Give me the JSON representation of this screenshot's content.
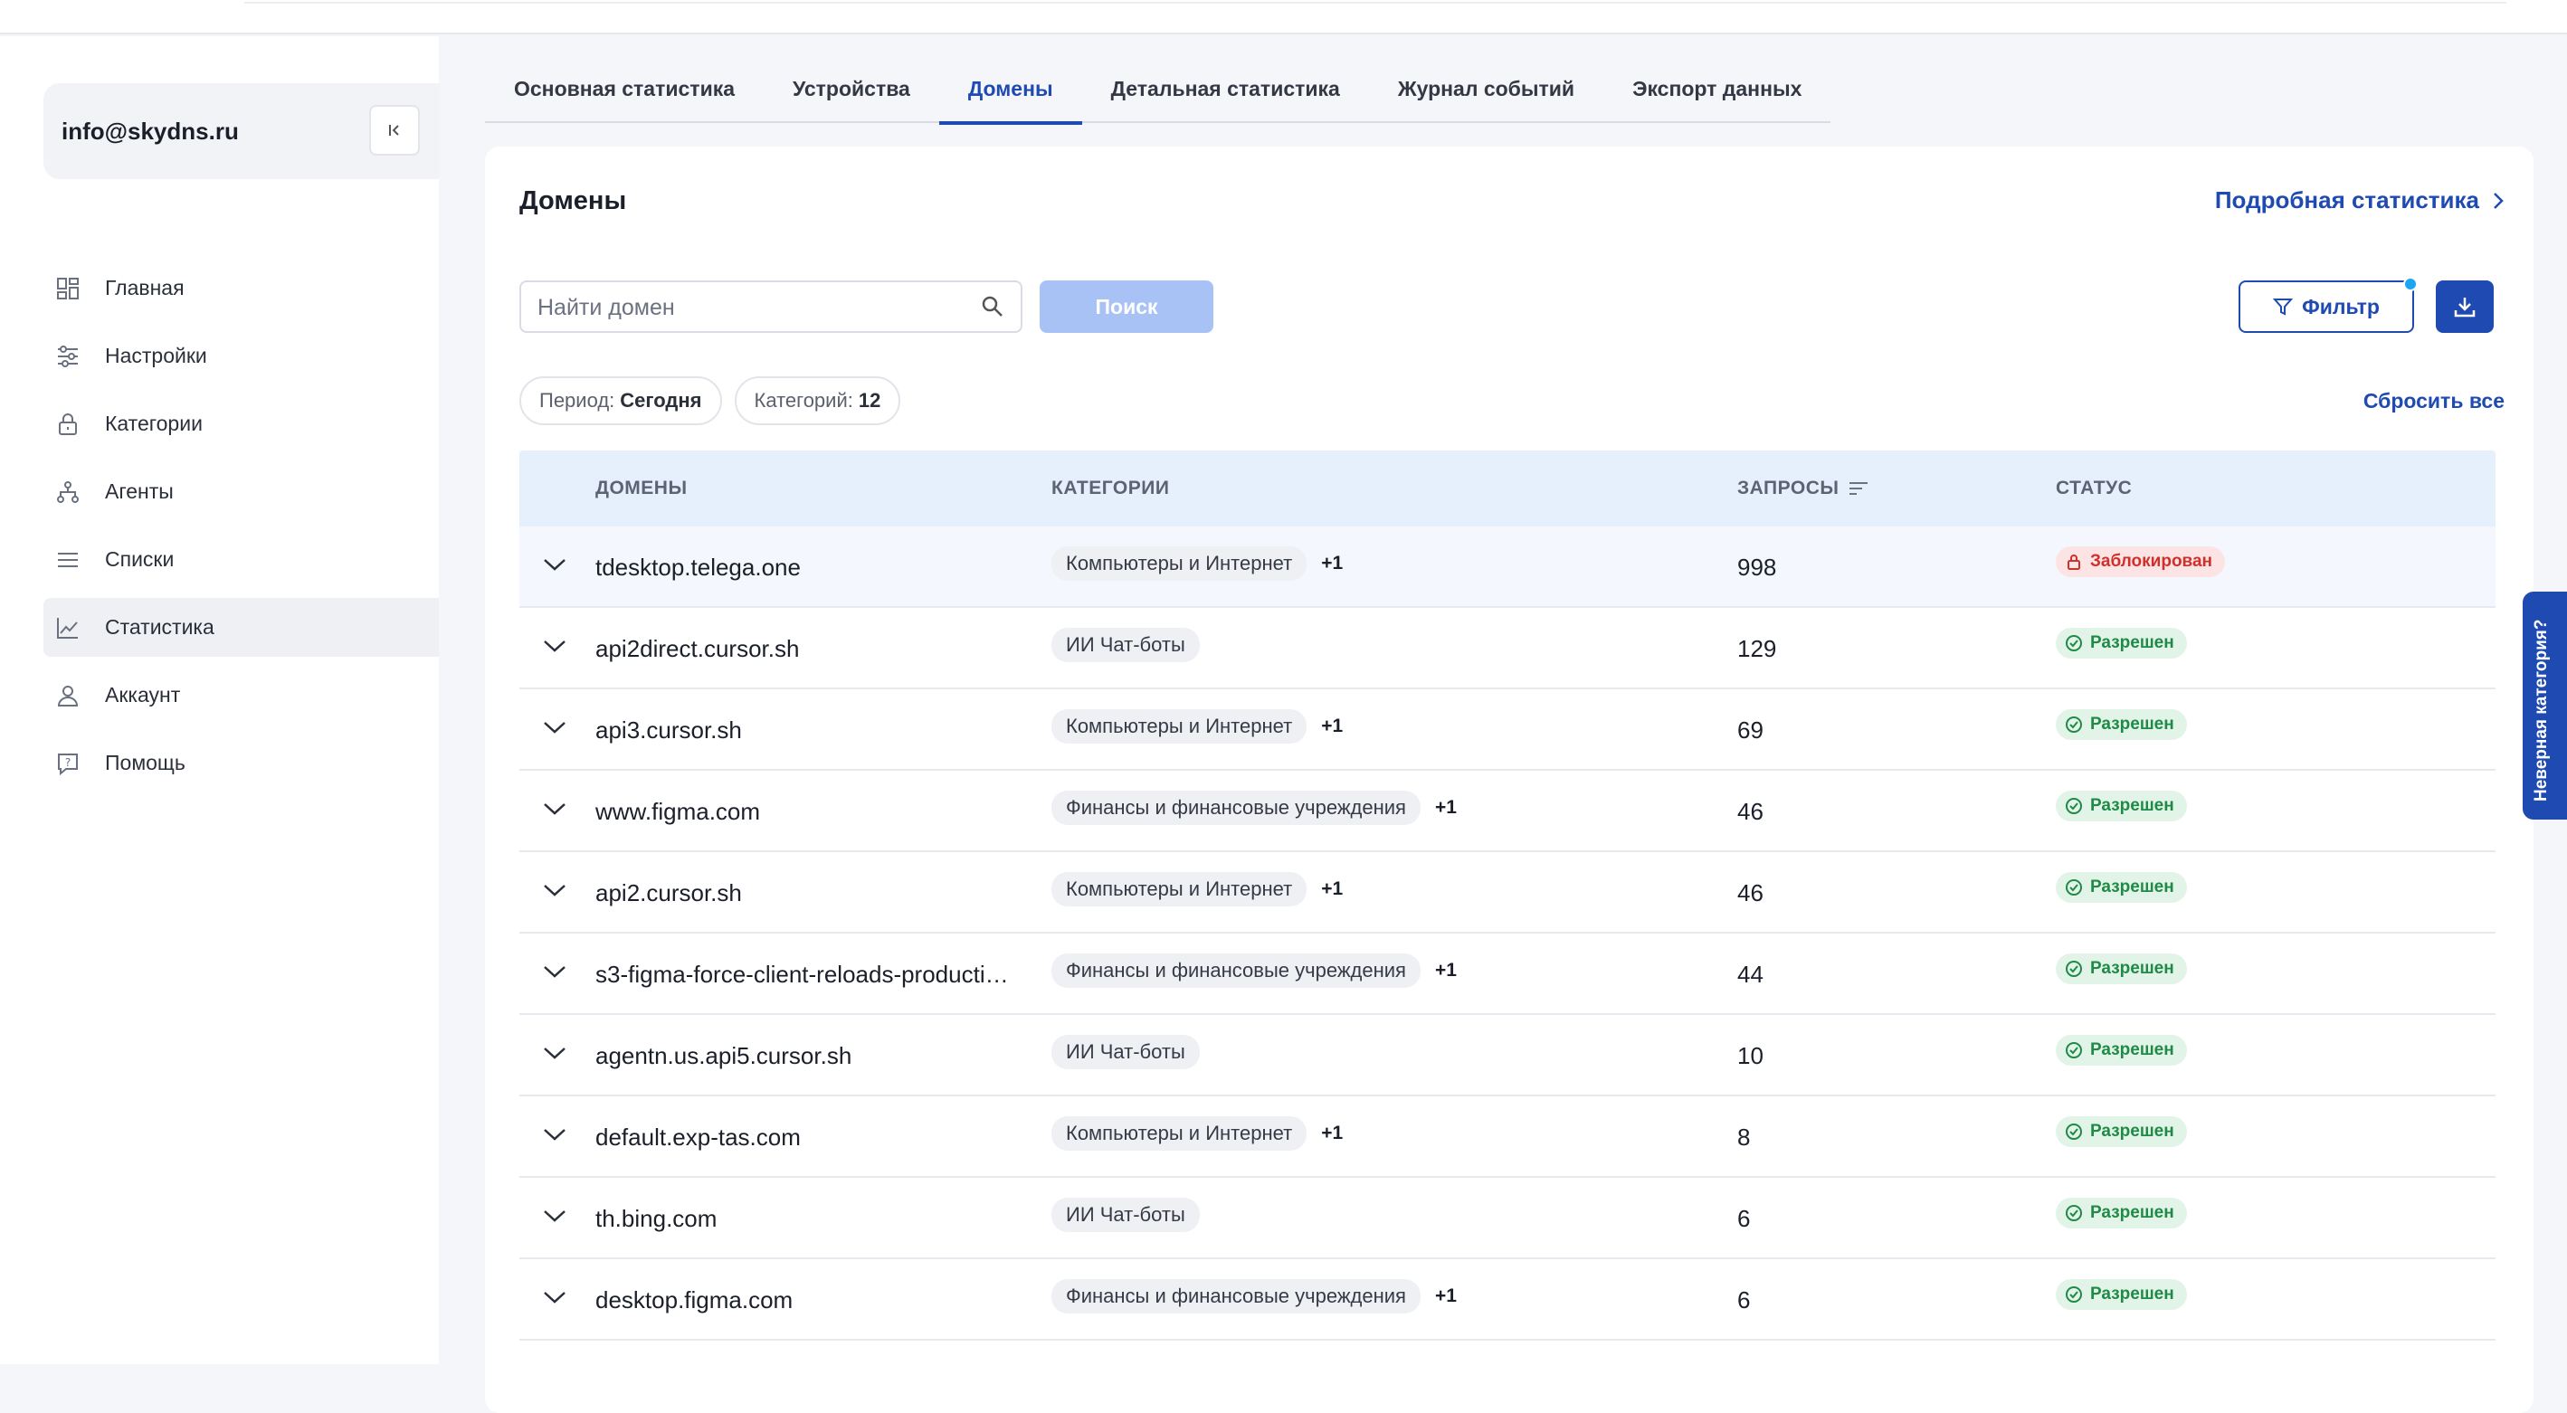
{
  "account": {
    "email": "info@skydns.ru"
  },
  "nav": [
    {
      "label": "Главная",
      "icon": "grid-icon"
    },
    {
      "label": "Настройки",
      "icon": "sliders-icon"
    },
    {
      "label": "Категории",
      "icon": "lock-icon"
    },
    {
      "label": "Агенты",
      "icon": "network-icon"
    },
    {
      "label": "Списки",
      "icon": "list-icon"
    },
    {
      "label": "Статистика",
      "icon": "chart-icon",
      "active": true
    },
    {
      "label": "Аккаунт",
      "icon": "user-icon"
    },
    {
      "label": "Помощь",
      "icon": "help-icon"
    }
  ],
  "tabs": [
    {
      "label": "Основная статистика"
    },
    {
      "label": "Устройства"
    },
    {
      "label": "Домены",
      "active": true
    },
    {
      "label": "Детальная статистика"
    },
    {
      "label": "Журнал событий"
    },
    {
      "label": "Экспорт данных"
    }
  ],
  "card": {
    "title": "Домены",
    "detail_link": "Подробная статистика",
    "search_placeholder": "Найти домен",
    "search_button": "Поиск",
    "filter_button": "Фильтр",
    "period_label": "Период:",
    "period_value": "Сегодня",
    "categories_label": "Категорий:",
    "categories_value": "12",
    "reset_link": "Сбросить все"
  },
  "table": {
    "headers": {
      "domain": "ДОМЕНЫ",
      "categories": "КАТЕГОРИИ",
      "requests": "ЗАПРОСЫ",
      "status": "СТАТУС"
    },
    "rows": [
      {
        "domain": "tdesktop.telega.one",
        "category": "Компьютеры и Интернет",
        "extra": "+1",
        "requests": "998",
        "status": "Заблокирован",
        "status_type": "blocked"
      },
      {
        "domain": "api2direct.cursor.sh",
        "category": "ИИ Чат-боты",
        "extra": "",
        "requests": "129",
        "status": "Разрешен",
        "status_type": "ok"
      },
      {
        "domain": "api3.cursor.sh",
        "category": "Компьютеры и Интернет",
        "extra": "+1",
        "requests": "69",
        "status": "Разрешен",
        "status_type": "ok"
      },
      {
        "domain": "www.figma.com",
        "category": "Финансы и финансовые учреждения",
        "extra": "+1",
        "requests": "46",
        "status": "Разрешен",
        "status_type": "ok"
      },
      {
        "domain": "api2.cursor.sh",
        "category": "Компьютеры и Интернет",
        "extra": "+1",
        "requests": "46",
        "status": "Разрешен",
        "status_type": "ok"
      },
      {
        "domain": "s3-figma-force-client-reloads-producti…",
        "category": "Финансы и финансовые учреждения",
        "extra": "+1",
        "requests": "44",
        "status": "Разрешен",
        "status_type": "ok"
      },
      {
        "domain": "agentn.us.api5.cursor.sh",
        "category": "ИИ Чат-боты",
        "extra": "",
        "requests": "10",
        "status": "Разрешен",
        "status_type": "ok"
      },
      {
        "domain": "default.exp-tas.com",
        "category": "Компьютеры и Интернет",
        "extra": "+1",
        "requests": "8",
        "status": "Разрешен",
        "status_type": "ok"
      },
      {
        "domain": "th.bing.com",
        "category": "ИИ Чат-боты",
        "extra": "",
        "requests": "6",
        "status": "Разрешен",
        "status_type": "ok"
      },
      {
        "domain": "desktop.figma.com",
        "category": "Финансы и финансовые учреждения",
        "extra": "+1",
        "requests": "6",
        "status": "Разрешен",
        "status_type": "ok"
      }
    ]
  },
  "feedback_tab": "Неверная категория?",
  "colors": {
    "accent": "#1f4ab1",
    "allowed": "#1f8a45",
    "blocked": "#d0302c"
  }
}
